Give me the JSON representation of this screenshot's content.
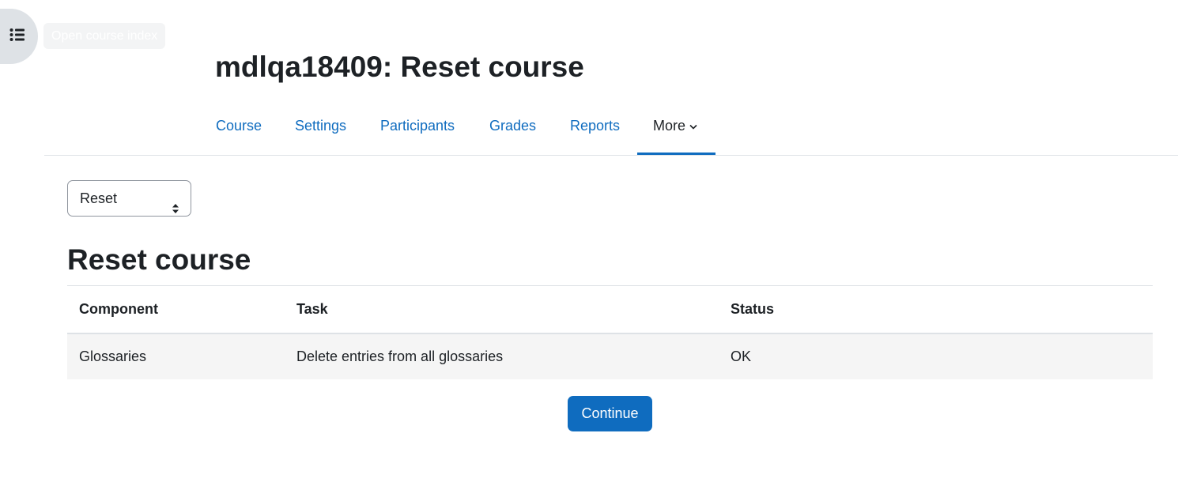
{
  "drawer": {
    "toggle_icon": "list-icon",
    "tooltip": "Open course index"
  },
  "header": {
    "title": "mdlqa18409: Reset course"
  },
  "nav": {
    "items": [
      {
        "label": "Course"
      },
      {
        "label": "Settings"
      },
      {
        "label": "Participants"
      },
      {
        "label": "Grades"
      },
      {
        "label": "Reports"
      },
      {
        "label": "More",
        "active": true,
        "icon": "chevron-down-icon"
      }
    ]
  },
  "action_select": {
    "selected": "Reset"
  },
  "main": {
    "heading": "Reset course",
    "table": {
      "headers": [
        "Component",
        "Task",
        "Status"
      ],
      "rows": [
        [
          "Glossaries",
          "Delete entries from all glossaries",
          "OK"
        ]
      ]
    },
    "continue_label": "Continue"
  },
  "colors": {
    "link": "#0f6cbf",
    "primary_button": "#0f6cbf",
    "text": "#1d2125",
    "row_bg": "#f5f5f5",
    "drawer_bg": "#dee2e6"
  }
}
